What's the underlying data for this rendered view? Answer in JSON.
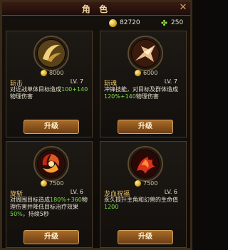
{
  "window": {
    "title": "角 色",
    "close": "✕"
  },
  "resources": {
    "gold": "82720",
    "gems": "250"
  },
  "skills": [
    {
      "name": "斩击",
      "cost": "8000",
      "level": "LV. 7",
      "desc_a": "对近战单体目标造成",
      "desc_b": "100+140",
      "desc_c": "物理伤害",
      "upgrade": "升级",
      "icon": "crescent-slash-icon"
    },
    {
      "name": "斩魂",
      "cost": "6000",
      "level": "LV. 7",
      "desc_a": "冲锋技能，对目标及群体造成",
      "desc_b": "120%+140",
      "desc_c": "物理伤害",
      "upgrade": "升级",
      "icon": "charging-warrior-icon"
    },
    {
      "name": "旋斩",
      "cost": "7500",
      "level": "LV. 6",
      "desc_a": "对周围目标造成",
      "desc_b": "180%+360",
      "desc_c": "物理伤害并降低目标治疗效果",
      "desc_d": "50%",
      "desc_e": "，持续5秒",
      "upgrade": "升级",
      "icon": "whirlwind-icon"
    },
    {
      "name": "龙血祝福",
      "cost": "7500",
      "level": "LV. 6",
      "desc_a": "永久提升主角和幻兽的生命值",
      "desc_b": "1200",
      "upgrade": "升级",
      "icon": "dragon-blood-icon"
    }
  ],
  "colors": {
    "accent": "#e7c26a",
    "highlight": "#7fe04a",
    "button": "#a86b2a"
  }
}
